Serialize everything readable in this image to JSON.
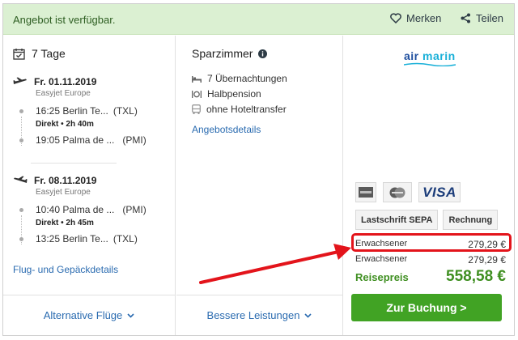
{
  "topbar": {
    "availability": "Angebot ist verfügbar.",
    "save_label": "Merken",
    "share_label": "Teilen"
  },
  "trip": {
    "duration": "7 Tage",
    "outbound": {
      "date": "Fr. 01.11.2019",
      "airline": "Easyjet Europe",
      "dep_time_place": "16:25 Berlin Te...",
      "dep_code": "(TXL)",
      "direct_label": "Direkt",
      "duration": "2h 40m",
      "arr_time_place": "19:05 Palma de ...",
      "arr_code": "(PMI)"
    },
    "return": {
      "date": "Fr. 08.11.2019",
      "airline": "Easyjet Europe",
      "dep_time_place": "10:40 Palma de ...",
      "dep_code": "(PMI)",
      "direct_label": "Direkt",
      "duration": "2h 45m",
      "arr_time_place": "13:25 Berlin Te...",
      "arr_code": "(TXL)"
    },
    "details_link": "Flug- und Gepäckdetails"
  },
  "room": {
    "title": "Sparzimmer",
    "amenities": [
      "7 Übernachtungen",
      "Halbpension",
      "ohne Hoteltransfer"
    ],
    "details_link": "Angebotsdetails"
  },
  "operator": {
    "logo_part1": "air",
    "logo_part2": "marin"
  },
  "payment": {
    "card3": "VISA",
    "option1": "Lastschrift SEPA",
    "option2": "Rechnung"
  },
  "pricing": {
    "lines": [
      {
        "label": "Erwachsener",
        "amount": "279,29 €"
      },
      {
        "label": "Erwachsener",
        "amount": "279,29 €"
      }
    ],
    "total_label": "Reisepreis",
    "total_amount": "558,58 €"
  },
  "footer": {
    "alt_flights": "Alternative Flüge",
    "better_services": "Bessere Leistungen",
    "book_button": "Zur Buchung >"
  },
  "colors": {
    "accent_green": "#41a324",
    "link_blue": "#2a6bb0",
    "highlight_red": "#e3141b",
    "topbar_bg": "#dbf0d2"
  }
}
